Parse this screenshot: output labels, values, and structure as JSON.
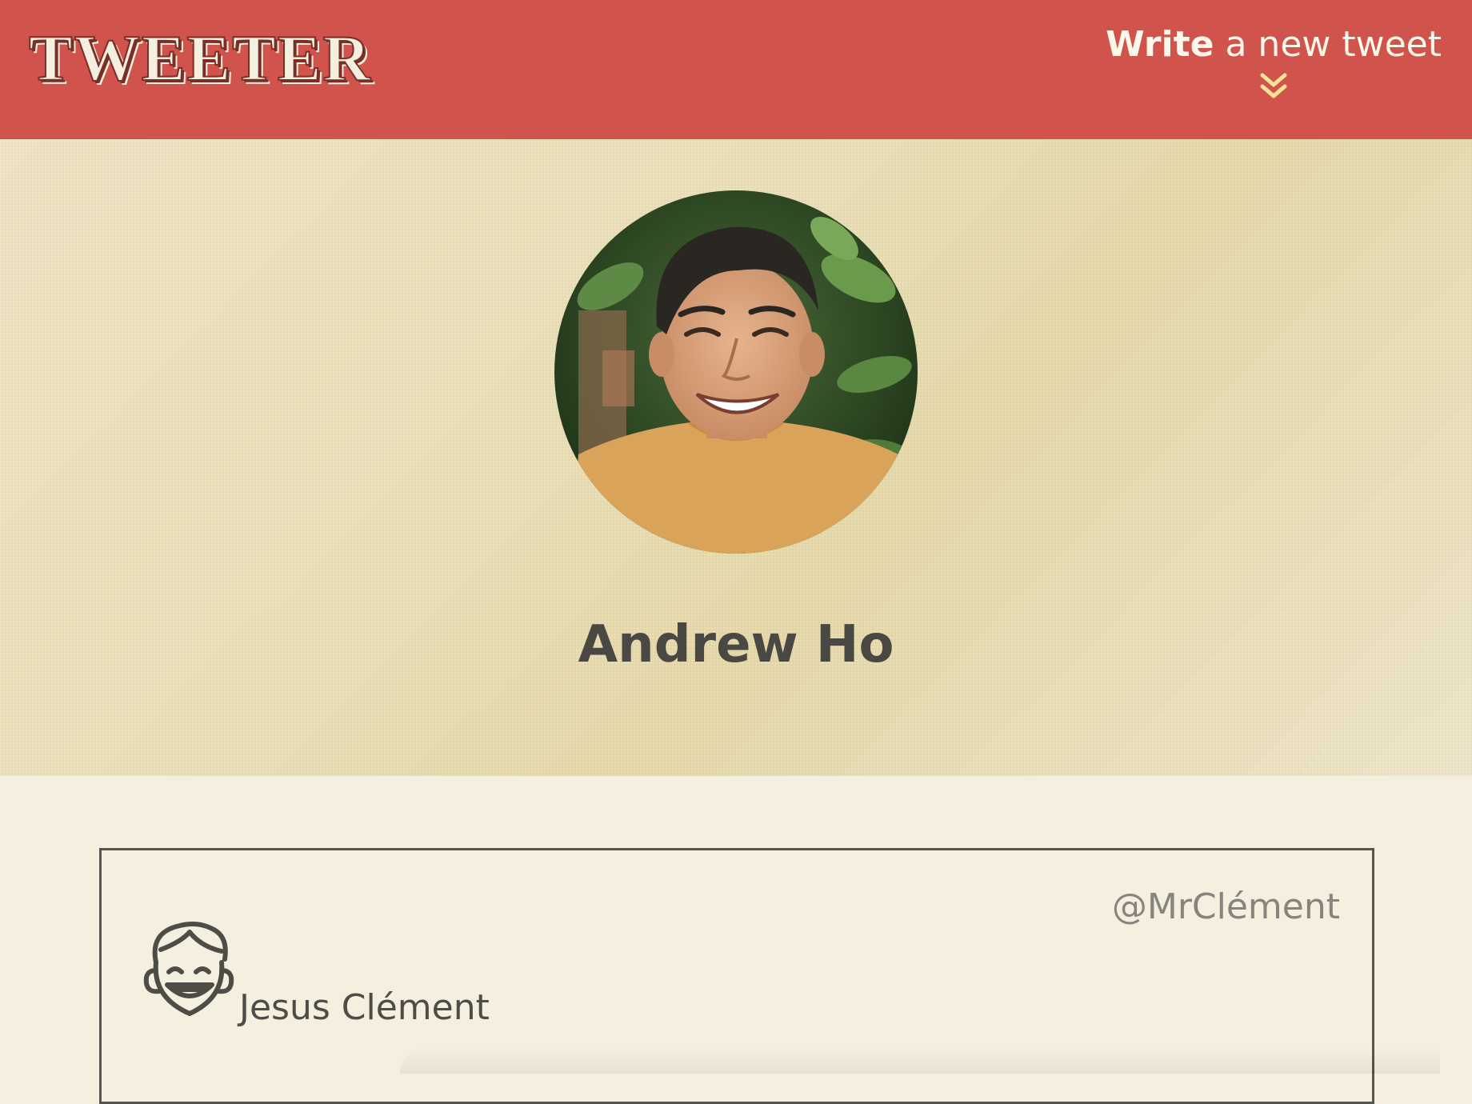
{
  "header": {
    "logo_text": "TWEETER",
    "compose_bold": "Write",
    "compose_rest": " a new tweet",
    "icon": "double-chevron-down-icon",
    "background_color": "#d0544c",
    "accent_color": "#f6e39a"
  },
  "profile": {
    "name": "Andrew Ho",
    "avatar_icon": "profile-photo"
  },
  "tweets": [
    {
      "handle": "@MrClément",
      "author_name": "Jesus Clément",
      "avatar_icon": "laughing-face-icon"
    }
  ]
}
